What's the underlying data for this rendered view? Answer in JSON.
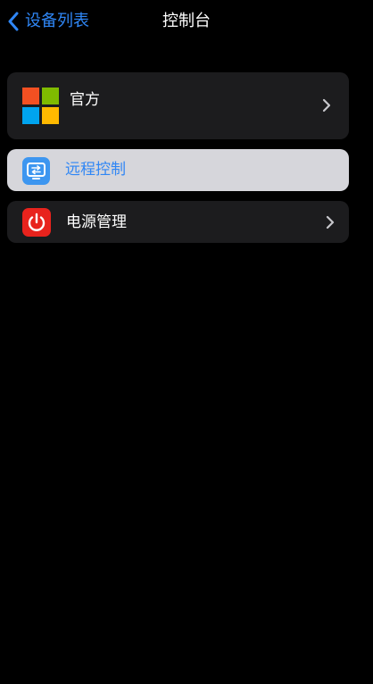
{
  "nav": {
    "back_label": "设备列表",
    "title": "控制台"
  },
  "menu": {
    "items": [
      {
        "label": "官方",
        "icon": "microsoft-logo-icon",
        "has_chevron": true
      },
      {
        "label": "远程控制",
        "icon": "remote-control-icon",
        "highlighted": true
      },
      {
        "label": "电源管理",
        "icon": "power-icon",
        "has_chevron": true
      }
    ]
  },
  "colors": {
    "accent": "#2f86f5",
    "background": "#000000",
    "card": "#1c1c1e",
    "highlight": "#d6d6db",
    "ms_red": "#f25022",
    "ms_green": "#7fba00",
    "ms_blue": "#00a4ef",
    "ms_yellow": "#ffb900",
    "power_red": "#e8231d",
    "remote_blue": "#3d96f0"
  }
}
